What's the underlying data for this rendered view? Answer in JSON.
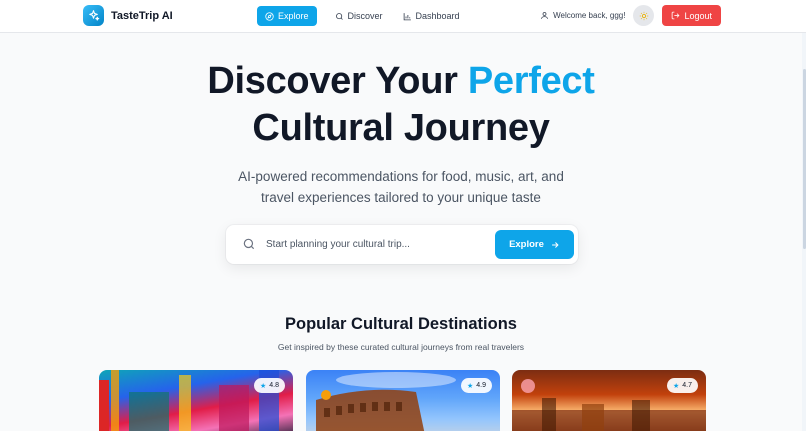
{
  "nav": {
    "brand": "TasteTrip AI",
    "links": [
      {
        "label": "Explore",
        "icon": "compass-icon",
        "active": true
      },
      {
        "label": "Discover",
        "icon": "search-icon",
        "active": false
      },
      {
        "label": "Dashboard",
        "icon": "bar-chart-icon",
        "active": false
      }
    ],
    "welcome": "Welcome back, ggg!",
    "logout": "Logout"
  },
  "hero": {
    "title_line1_a": "Discover Your ",
    "title_line1_b": "Perfect",
    "title_line2": "Cultural Journey",
    "subtitle_line1": "AI-powered recommendations for food, music, art, and",
    "subtitle_line2": "travel experiences tailored to your unique taste"
  },
  "search": {
    "placeholder": "Start planning your cultural trip...",
    "button": "Explore"
  },
  "destinations": {
    "title": "Popular Cultural Destinations",
    "subtitle": "Get inspired by these curated cultural journeys from real travelers",
    "cards": [
      {
        "rating": "4.8"
      },
      {
        "rating": "4.9"
      },
      {
        "rating": "4.7"
      }
    ]
  },
  "colors": {
    "accent": "#0ea5e9",
    "logout": "#ef4444"
  }
}
